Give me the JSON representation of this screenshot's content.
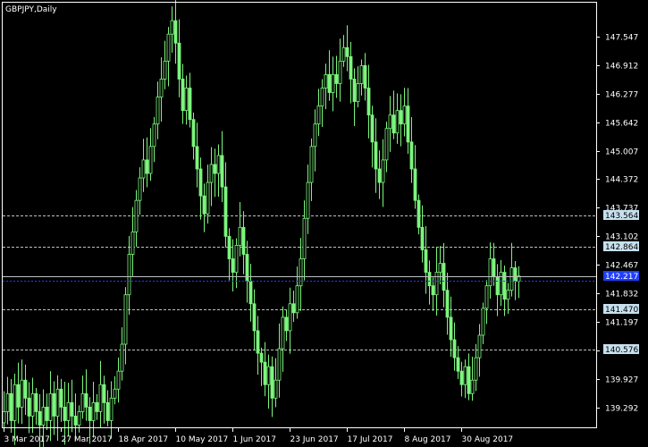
{
  "window": {
    "title": "GBPJPY,Daily"
  },
  "colors": {
    "background": "#000000",
    "frame": "#ffffff",
    "candle": "#7cf57c",
    "level_line": "#c0c0c0",
    "level_label_bg": "#c7e0ee",
    "bid_line": "#c0c0c0",
    "ask_line": "#1f3fff",
    "current_label_bg": "#1f3fff"
  },
  "chart_data": {
    "type": "candlestick",
    "symbol": "GBPJPY",
    "timeframe": "Daily",
    "ylim": [
      138.85,
      148.3
    ],
    "y_ticks": [
      "147.547",
      "146.912",
      "146.277",
      "145.642",
      "145.007",
      "144.372",
      "143.737",
      "143.102",
      "142.467",
      "141.832",
      "141.197",
      "140.562",
      "139.927",
      "139.292"
    ],
    "x_ticks": [
      {
        "label": "3 Mar 2017",
        "index": 0
      },
      {
        "label": "27 Mar 2017",
        "index": 16
      },
      {
        "label": "18 Apr 2017",
        "index": 32
      },
      {
        "label": "10 May 2017",
        "index": 48
      },
      {
        "label": "1 Jun 2017",
        "index": 64
      },
      {
        "label": "23 Jun 2017",
        "index": 80
      },
      {
        "label": "17 Jul 2017",
        "index": 96
      },
      {
        "label": "8 Aug 2017",
        "index": 112
      },
      {
        "label": "30 Aug 2017",
        "index": 128
      }
    ],
    "levels": [
      {
        "value": 143.564,
        "label": "143.564"
      },
      {
        "value": 142.864,
        "label": "142.864"
      },
      {
        "value": 141.47,
        "label": "141.470"
      },
      {
        "value": 140.576,
        "label": "140.576"
      }
    ],
    "bid": {
      "value": 142.217,
      "label": "142.217"
    },
    "ask": {
      "value": 142.117
    },
    "series": [
      {
        "name": "GBPJPY",
        "closes": [
          139.2,
          139.6,
          139.0,
          139.8,
          139.3,
          139.9,
          139.5,
          139.1,
          139.6,
          139.2,
          138.9,
          139.3,
          139.0,
          139.6,
          139.1,
          139.7,
          139.3,
          139.0,
          139.4,
          139.1,
          138.9,
          139.2,
          139.6,
          139.3,
          139.0,
          139.4,
          139.2,
          139.8,
          139.4,
          139.0,
          139.5,
          139.7,
          140.1,
          140.7,
          141.8,
          142.7,
          143.2,
          143.9,
          144.4,
          144.8,
          144.5,
          145.1,
          145.6,
          146.2,
          146.6,
          147.0,
          147.6,
          147.9,
          147.4,
          146.6,
          145.9,
          146.4,
          145.7,
          145.1,
          144.6,
          144.0,
          143.6,
          144.3,
          144.7,
          144.5,
          144.9,
          144.2,
          143.1,
          142.6,
          142.3,
          142.9,
          143.3,
          142.7,
          142.1,
          141.6,
          141.0,
          140.5,
          140.3,
          139.8,
          140.2,
          139.5,
          139.9,
          140.6,
          141.3,
          141.0,
          141.6,
          141.4,
          142.0,
          142.6,
          143.5,
          144.3,
          145.1,
          145.6,
          146.0,
          146.4,
          146.7,
          146.3,
          146.7,
          146.5,
          147.0,
          147.3,
          147.1,
          146.6,
          146.1,
          146.5,
          146.9,
          146.4,
          145.8,
          145.2,
          144.6,
          144.3,
          144.8,
          145.5,
          145.8,
          145.4,
          145.9,
          145.6,
          146.0,
          145.2,
          144.6,
          143.9,
          143.3,
          142.8,
          142.3,
          142.0,
          141.8,
          142.3,
          142.5,
          141.9,
          141.3,
          140.8,
          140.4,
          140.1,
          139.8,
          140.2,
          139.6,
          139.9,
          140.4,
          140.9,
          141.5,
          142.0,
          142.6,
          142.2,
          141.8,
          142.3,
          141.7,
          141.9,
          142.4,
          142.1,
          142.217
        ]
      }
    ]
  }
}
